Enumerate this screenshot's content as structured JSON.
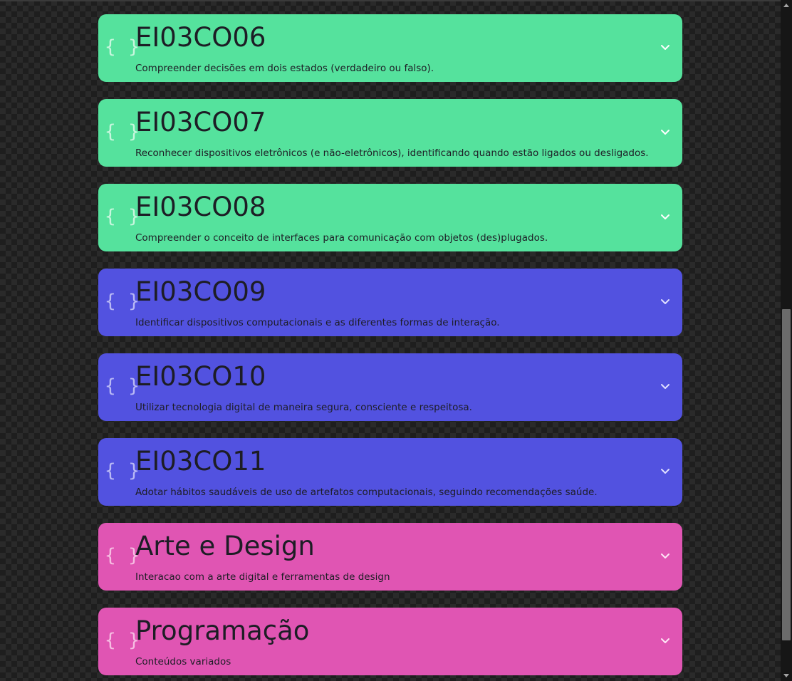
{
  "cards": [
    {
      "color": "green",
      "brace": "{ }",
      "title": "EI03CO06",
      "description": "Compreender decisões em dois estados (verdadeiro ou falso).",
      "icon": "chevron-down-icon"
    },
    {
      "color": "green",
      "brace": "{ }",
      "title": "EI03CO07",
      "description": "Reconhecer dispositivos eletrônicos (e não-eletrônicos), identificando quando estão ligados ou desligados.",
      "icon": "chevron-down-icon"
    },
    {
      "color": "green",
      "brace": "{ }",
      "title": "EI03CO08",
      "description": "Compreender o conceito de interfaces para comunicação com objetos (des)plugados.",
      "icon": "chevron-down-icon"
    },
    {
      "color": "blue",
      "brace": "{ }",
      "title": "EI03CO09",
      "description": "Identificar dispositivos computacionais e as diferentes formas de interação.",
      "icon": "chevron-down-icon"
    },
    {
      "color": "blue",
      "brace": "{ }",
      "title": "EI03CO10",
      "description": "Utilizar tecnologia digital de maneira segura, consciente e respeitosa.",
      "icon": "chevron-down-icon"
    },
    {
      "color": "blue",
      "brace": "{ }",
      "title": "EI03CO11",
      "description": "Adotar hábitos saudáveis de uso de artefatos computacionais, seguindo recomendações saúde.",
      "icon": "chevron-down-icon"
    },
    {
      "color": "pink",
      "brace": "{ }",
      "title": "Arte e Design",
      "description": "Interacao com a arte digital e ferramentas de design",
      "icon": "chevron-down-icon"
    },
    {
      "color": "pink",
      "brace": "{ }",
      "title": "Programação",
      "description": "Conteúdos variados",
      "icon": "chevron-down-icon"
    }
  ],
  "colors": {
    "green": "#55e29d",
    "blue": "#5252e0",
    "pink": "#e055b3",
    "background": "#1e1e1e"
  }
}
